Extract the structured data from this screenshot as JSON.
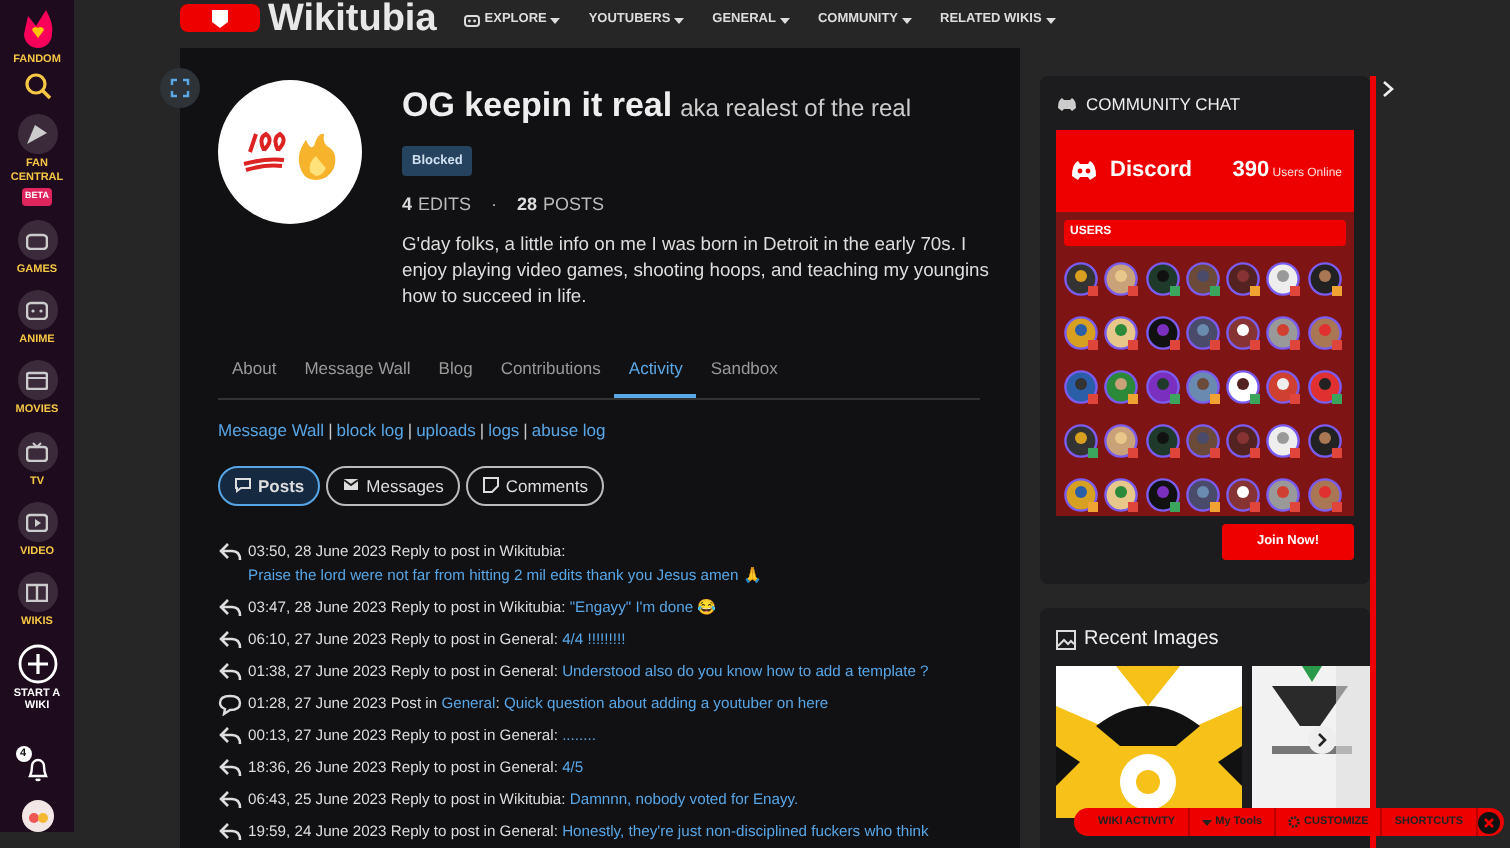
{
  "rail": {
    "brand": "FANDOM",
    "items": [
      {
        "kind": "fan",
        "label": "FAN CENTRAL",
        "badge": "BETA"
      },
      {
        "kind": "games",
        "label": "GAMES"
      },
      {
        "kind": "anime",
        "label": "ANIME"
      },
      {
        "kind": "movies",
        "label": "MOVIES"
      },
      {
        "kind": "tv",
        "label": "TV"
      },
      {
        "kind": "video",
        "label": "VIDEO"
      },
      {
        "kind": "wikis",
        "label": "WIKIS"
      },
      {
        "kind": "start",
        "label": "START A WIKI"
      }
    ],
    "notifications": "4"
  },
  "header": {
    "wiki": "Wikitubia",
    "nav": [
      {
        "label": "EXPLORE",
        "kind": "explore"
      },
      {
        "label": "YOUTUBERS"
      },
      {
        "label": "GENERAL"
      },
      {
        "label": "COMMUNITY"
      },
      {
        "label": "RELATED WIKIS"
      }
    ]
  },
  "profile": {
    "name": "OG keepin it real",
    "aka": "aka realest of the real",
    "status": "Blocked",
    "stats": [
      {
        "value": "4",
        "label": "EDITS"
      },
      {
        "value": "28",
        "label": "POSTS"
      }
    ],
    "stats_separator": "·",
    "bio": "G'day folks, a little info on me I was born in Detroit in the early 70s. I enjoy playing video games, shooting hoops, and teaching my youngins how to succeed in life."
  },
  "tabs": [
    {
      "label": "About",
      "selected": false
    },
    {
      "label": "Message Wall",
      "selected": false
    },
    {
      "label": "Blog",
      "selected": false
    },
    {
      "label": "Contributions",
      "selected": false
    },
    {
      "label": "Activity",
      "selected": true
    },
    {
      "label": "Sandbox",
      "selected": false
    }
  ],
  "tool_links": [
    "Message Wall",
    "block log",
    "uploads",
    "logs",
    "abuse log"
  ],
  "tool_link_separator": "|",
  "filters": [
    {
      "label": "Posts",
      "kind": "posts",
      "selected": true
    },
    {
      "label": "Messages",
      "kind": "messages",
      "selected": false
    },
    {
      "label": "Comments",
      "kind": "comments",
      "selected": false
    }
  ],
  "entries": [
    {
      "kind": "reply",
      "meta": "03:50, 28 June 2023 Reply to post in Wikitubia:",
      "link": "Praise the lord were not far from hitting 2 mil edits thank you Jesus amen 🙏"
    },
    {
      "kind": "reply",
      "meta": "03:47, 28 June 2023 Reply to post in Wikitubia:",
      "link": "\"Engayy\" I'm done 😂"
    },
    {
      "kind": "reply",
      "meta": "06:10, 27 June 2023 Reply to post in General:",
      "link": "4/4 !!!!!!!!!"
    },
    {
      "kind": "reply",
      "meta": "01:38, 27 June 2023 Reply to post in General:",
      "link": "Understood also do you know how to add a template ?"
    },
    {
      "kind": "post",
      "meta": "01:28, 27 June 2023 Post in",
      "board": "General",
      "after": ":",
      "link": "Quick question about adding a youtuber on here"
    },
    {
      "kind": "reply",
      "meta": "00:13, 27 June 2023 Reply to post in General:",
      "link": "........"
    },
    {
      "kind": "reply",
      "meta": "18:36, 26 June 2023 Reply to post in General:",
      "link": "4/5"
    },
    {
      "kind": "reply",
      "meta": "06:43, 25 June 2023 Reply to post in Wikitubia:",
      "link": "Damnnn, nobody voted for Enayy."
    },
    {
      "kind": "reply",
      "meta": "19:59, 24 June 2023 Reply to post in General:",
      "link": "Honestly, they're just non-disciplined fuckers who think"
    }
  ],
  "chat": {
    "title": "COMMUNITY CHAT",
    "service": "Discord",
    "online_count": "390",
    "online_label": "Users Online",
    "users_heading": "USERS",
    "join": "Join Now!",
    "users": [
      {
        "color": "#e0453c"
      },
      {
        "color": "#e0453c"
      },
      {
        "color": "#3ba55d"
      },
      {
        "color": "#3ba55d"
      },
      {
        "color": "#f0a232"
      },
      {
        "color": "#e0453c"
      },
      {
        "color": "#f0a232"
      },
      {
        "color": "#e0453c"
      },
      {
        "color": "#e0453c"
      },
      {
        "color": "#e0453c"
      },
      {
        "color": "#e0453c"
      },
      {
        "color": "#e0453c"
      },
      {
        "color": "#e0453c"
      },
      {
        "color": "#e0453c"
      },
      {
        "color": "#e0453c"
      },
      {
        "color": "#f0a232"
      },
      {
        "color": "#3ba55d"
      },
      {
        "color": "#f0a232"
      },
      {
        "color": "#3ba55d"
      },
      {
        "color": "#e0453c"
      },
      {
        "color": "#3ba55d"
      },
      {
        "color": "#3ba55d"
      },
      {
        "color": "#e0453c"
      },
      {
        "color": "#e0453c"
      },
      {
        "color": "#e0453c"
      },
      {
        "color": "#e0453c"
      },
      {
        "color": "#e0453c"
      },
      {
        "color": "#e0453c"
      },
      {
        "color": "#f0a232"
      },
      {
        "color": "#e0453c"
      },
      {
        "color": "#3ba55d"
      },
      {
        "color": "#f0a232"
      },
      {
        "color": "#e0453c"
      },
      {
        "color": "#e0453c"
      },
      {
        "color": "#e0453c"
      }
    ]
  },
  "recent_images": {
    "title": "Recent Images"
  },
  "toolbar": [
    {
      "label": "WIKI ACTIVITY",
      "kind": "plain"
    },
    {
      "label": "My Tools",
      "kind": "menu"
    },
    {
      "label": "CUSTOMIZE",
      "kind": "gear"
    },
    {
      "label": "SHORTCUTS",
      "kind": "plain"
    }
  ]
}
